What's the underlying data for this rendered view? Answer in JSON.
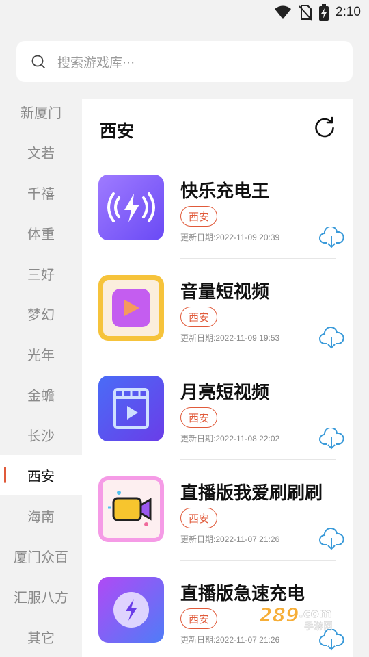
{
  "status_bar": {
    "time": "2:10"
  },
  "search": {
    "placeholder": "搜索游戏库···"
  },
  "sidebar": {
    "items": [
      {
        "label": "新厦门"
      },
      {
        "label": "文若"
      },
      {
        "label": "千禧"
      },
      {
        "label": "体重"
      },
      {
        "label": "三好"
      },
      {
        "label": "梦幻"
      },
      {
        "label": "光年"
      },
      {
        "label": "金蟾"
      },
      {
        "label": "长沙"
      },
      {
        "label": "西安",
        "active": true
      },
      {
        "label": "海南"
      },
      {
        "label": "厦门众百"
      },
      {
        "label": "汇服八方"
      },
      {
        "label": "其它"
      }
    ]
  },
  "content": {
    "title": "西安",
    "apps": [
      {
        "name": "快乐充电王",
        "tag": "西安",
        "date": "更新日期:2022-11-09 20:39",
        "icon": "charging-wave-icon"
      },
      {
        "name": "音量短视频",
        "tag": "西安",
        "date": "更新日期:2022-11-09 19:53",
        "icon": "video-play-icon"
      },
      {
        "name": "月亮短视频",
        "tag": "西安",
        "date": "更新日期:2022-11-08 22:02",
        "icon": "film-play-icon"
      },
      {
        "name": "直播版我爱刷刷刷",
        "tag": "西安",
        "date": "更新日期:2022-11-07 21:26",
        "icon": "camera-icon"
      },
      {
        "name": "直播版急速充电",
        "tag": "西安",
        "date": "更新日期:2022-11-07 21:26",
        "icon": "bolt-icon"
      }
    ]
  },
  "watermark": {
    "text": "289.com",
    "sub": "手游网"
  },
  "colors": {
    "accent": "#e05a3a",
    "download": "#3a9ad9",
    "background": "#f2f2f2"
  }
}
